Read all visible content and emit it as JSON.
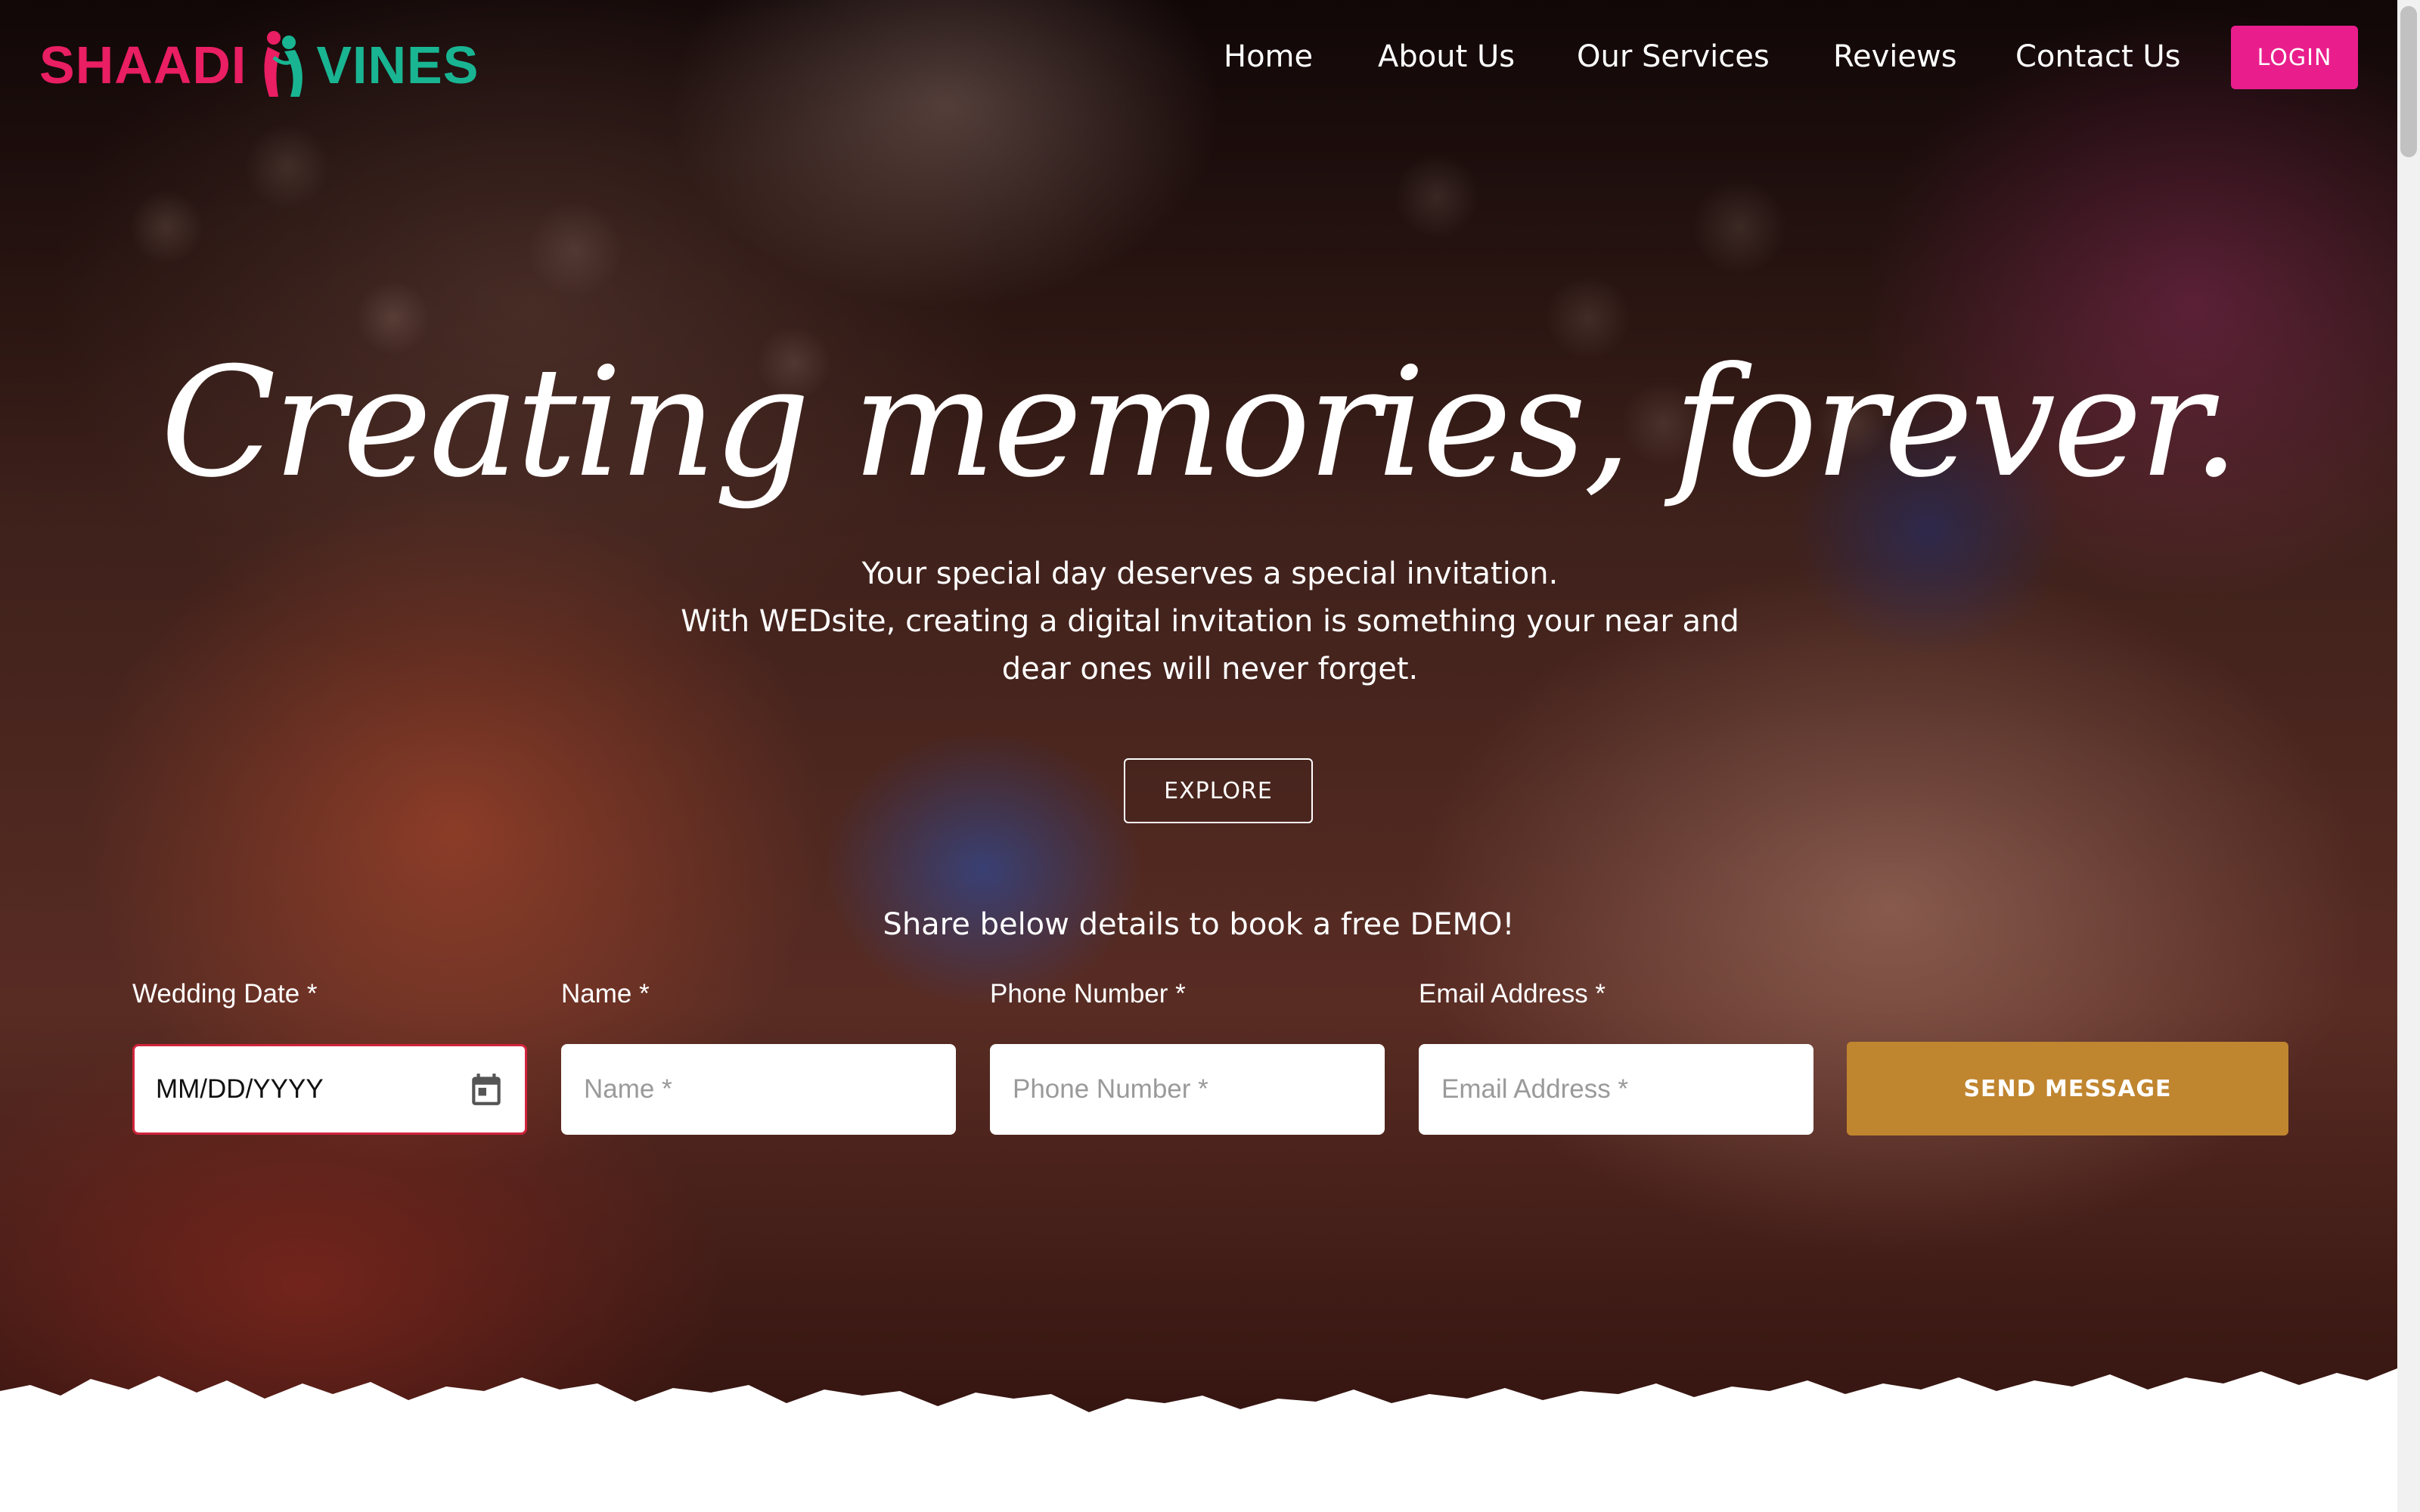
{
  "brand": {
    "part1": "SHAADI",
    "part2": "VINES",
    "color_pink": "#e91e63",
    "color_teal": "#19b592"
  },
  "nav": {
    "items": [
      "Home",
      "About Us",
      "Our Services",
      "Reviews",
      "Contact Us"
    ],
    "login_label": "LOGIN",
    "login_color": "#e91e8c"
  },
  "hero": {
    "headline": "Creating memories, forever.",
    "sub_line1": "Your special day deserves a special invitation.",
    "sub_line2": "With WEDsite, creating a digital invitation is something your near and",
    "sub_line3": "dear ones will never forget.",
    "explore_label": "EXPLORE"
  },
  "form": {
    "intro": "Share below details to book a free DEMO!",
    "wedding_date": {
      "label": "Wedding Date *",
      "value": "MM/DD/YYYY"
    },
    "name": {
      "label": "Name *",
      "placeholder": "Name *"
    },
    "phone": {
      "label": "Phone Number *",
      "placeholder": "Phone Number *"
    },
    "email": {
      "label": "Email Address *",
      "placeholder": "Email Address *"
    },
    "submit_label": "SEND MESSAGE",
    "submit_color": "#c0852f"
  },
  "icons": {
    "calendar": "calendar-icon",
    "logo_mark": "couple-icon"
  }
}
